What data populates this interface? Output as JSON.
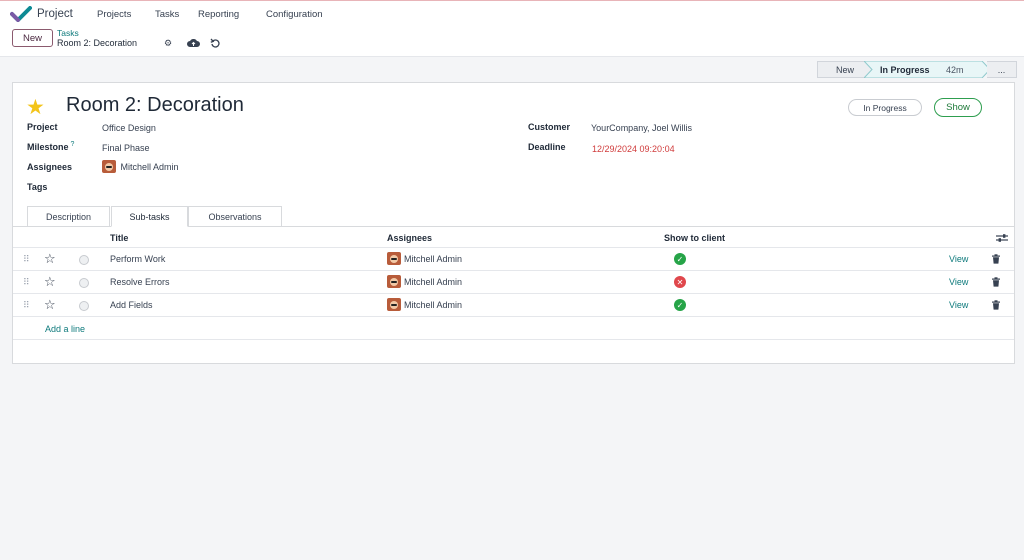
{
  "topbar": {
    "app_name": "Project",
    "menu": [
      "Projects",
      "Tasks",
      "Reporting",
      "Configuration"
    ]
  },
  "controlbar": {
    "new_label": "New",
    "breadcrumb_parent": "Tasks",
    "breadcrumb_current": "Room 2: Decoration",
    "icons": [
      "gear-icon",
      "cloud-upload-icon",
      "undo-icon"
    ]
  },
  "stages": {
    "new": "New",
    "current": "In Progress",
    "current_time": "42m",
    "more": "..."
  },
  "record": {
    "title": "Room 2: Decoration",
    "starred": true,
    "state_badge": "In Progress",
    "show_button": "Show",
    "fields": {
      "project_label": "Project",
      "project_value": "Office Design",
      "milestone_label": "Milestone",
      "milestone_help": "?",
      "milestone_value": "Final Phase",
      "assignees_label": "Assignees",
      "assignees_value": "Mitchell Admin",
      "tags_label": "Tags",
      "customer_label": "Customer",
      "customer_value": "YourCompany, Joel Willis",
      "deadline_label": "Deadline",
      "deadline_value": "12/29/2024 09:20:04"
    },
    "colors": {
      "deadline": "#d03c3c",
      "accent": "#0e7a7c",
      "star": "#f3c41a"
    }
  },
  "tabs": [
    "Description",
    "Sub-tasks",
    "Observations"
  ],
  "active_tab": "Sub-tasks",
  "subtasks": {
    "headers": {
      "title": "Title",
      "assignees": "Assignees",
      "show": "Show to client"
    },
    "rows": [
      {
        "title": "Perform Work",
        "assignee": "Mitchell Admin",
        "show_to_client": true,
        "action": "View"
      },
      {
        "title": "Resolve Errors",
        "assignee": "Mitchell Admin",
        "show_to_client": false,
        "action": "View"
      },
      {
        "title": "Add Fields",
        "assignee": "Mitchell Admin",
        "show_to_client": true,
        "action": "View"
      }
    ],
    "add_line": "Add a line"
  }
}
